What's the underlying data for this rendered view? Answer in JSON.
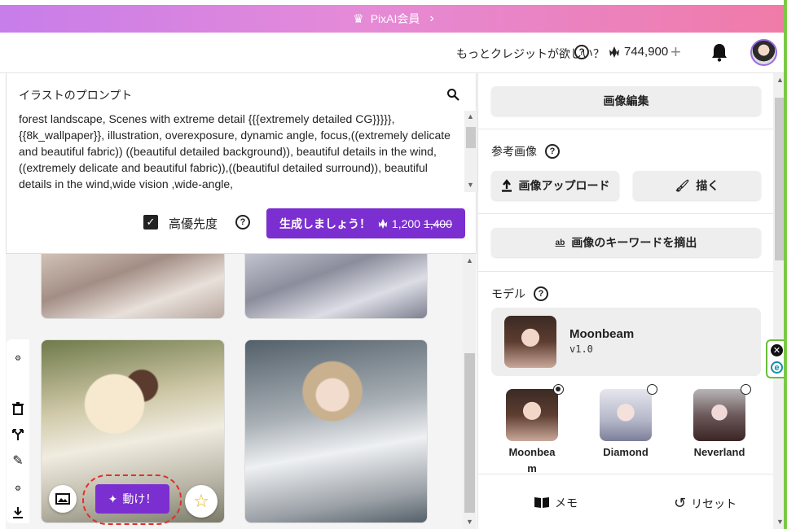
{
  "banner": {
    "label": "PixAI会員",
    "icon": "crown-icon"
  },
  "header": {
    "credit_question": "もっとクレジットが欲しい？",
    "credits": "744,900",
    "plus": "+",
    "notification_icon": "bell-icon"
  },
  "prompt": {
    "title": "イラストのプロンプト",
    "text": "forest landscape, Scenes with extreme detail {{{extremely detailed CG}}}}}, {{8k_wallpaper}}, illustration, overexposure, dynamic angle, focus,((extremely delicate and beautiful fabric)) ((beautiful detailed background)), beautiful details in the wind, ((extremely delicate and beautiful fabric)),((beautiful detailed surround)), beautiful details in the wind,wide vision ,wide-angle,",
    "high_priority_label": "高優先度",
    "high_priority_checked": true,
    "generate_label": "生成しましょう！",
    "generate_cost": "1,200",
    "generate_old_cost": "1,400"
  },
  "gallery": {
    "animate_label": "動け！"
  },
  "right": {
    "edit_image": "画像編集",
    "reference_title": "参考画像",
    "upload_label": "画像アップロード",
    "draw_label": "描く",
    "extract_keywords": "画像のキーワードを摘出",
    "model_title": "モデル",
    "selected_model": {
      "name": "Moonbeam",
      "version": "v1.0"
    },
    "model_options": [
      {
        "name": "Moonbea\nm",
        "selected": true
      },
      {
        "name": "Diamond",
        "selected": false
      },
      {
        "name": "Neverland",
        "selected": false
      }
    ],
    "memo_label": "メモ",
    "reset_label": "リセット"
  },
  "colors": {
    "primary": "#7b2fd0",
    "banner_start": "#c77dea",
    "banner_end": "#f07ba8",
    "annotation": "#e0302a"
  }
}
